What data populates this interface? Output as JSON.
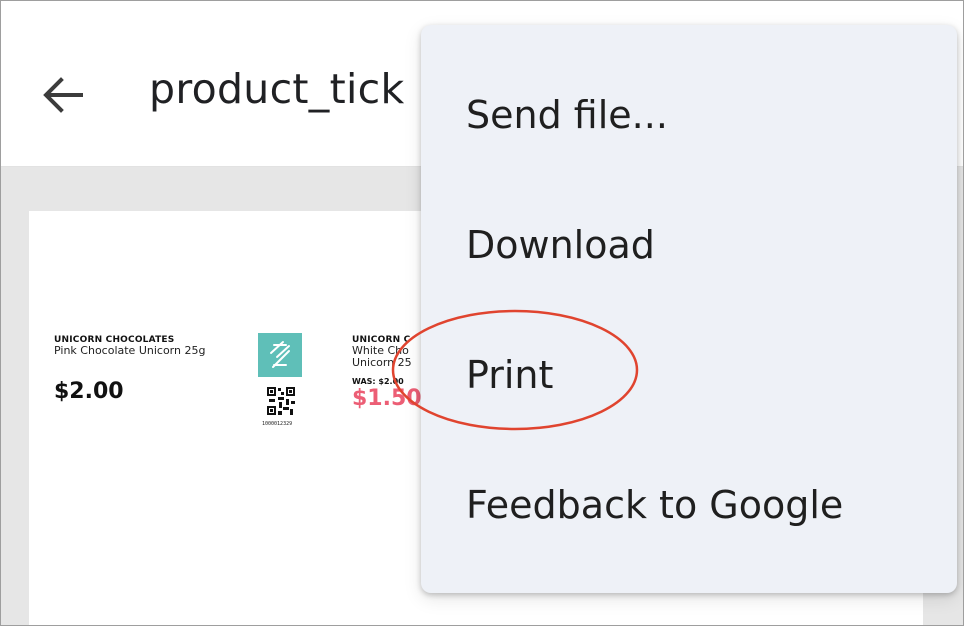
{
  "header": {
    "title": "product_tick",
    "back_icon": "arrow-left-icon"
  },
  "tickets": [
    {
      "brand": "UNICORN CHOCOLATES",
      "name": "Pink Chocolate Unicorn 25g",
      "price": "$2.00",
      "barcode": "1000012329"
    },
    {
      "brand": "UNICORN C",
      "name": "White Cho Unicorn 25",
      "was": "WAS: $2.00",
      "sale_price": "$1.50"
    }
  ],
  "menu": {
    "items": [
      {
        "label": "Send file..."
      },
      {
        "label": "Download"
      },
      {
        "label": "Print"
      },
      {
        "label": "Feedback to Google"
      }
    ]
  },
  "colors": {
    "menu_bg": "#eef1f7",
    "logo_teal": "#5fbfb8",
    "sale_red": "#ec5e75",
    "annotation_red": "#e0442f"
  }
}
